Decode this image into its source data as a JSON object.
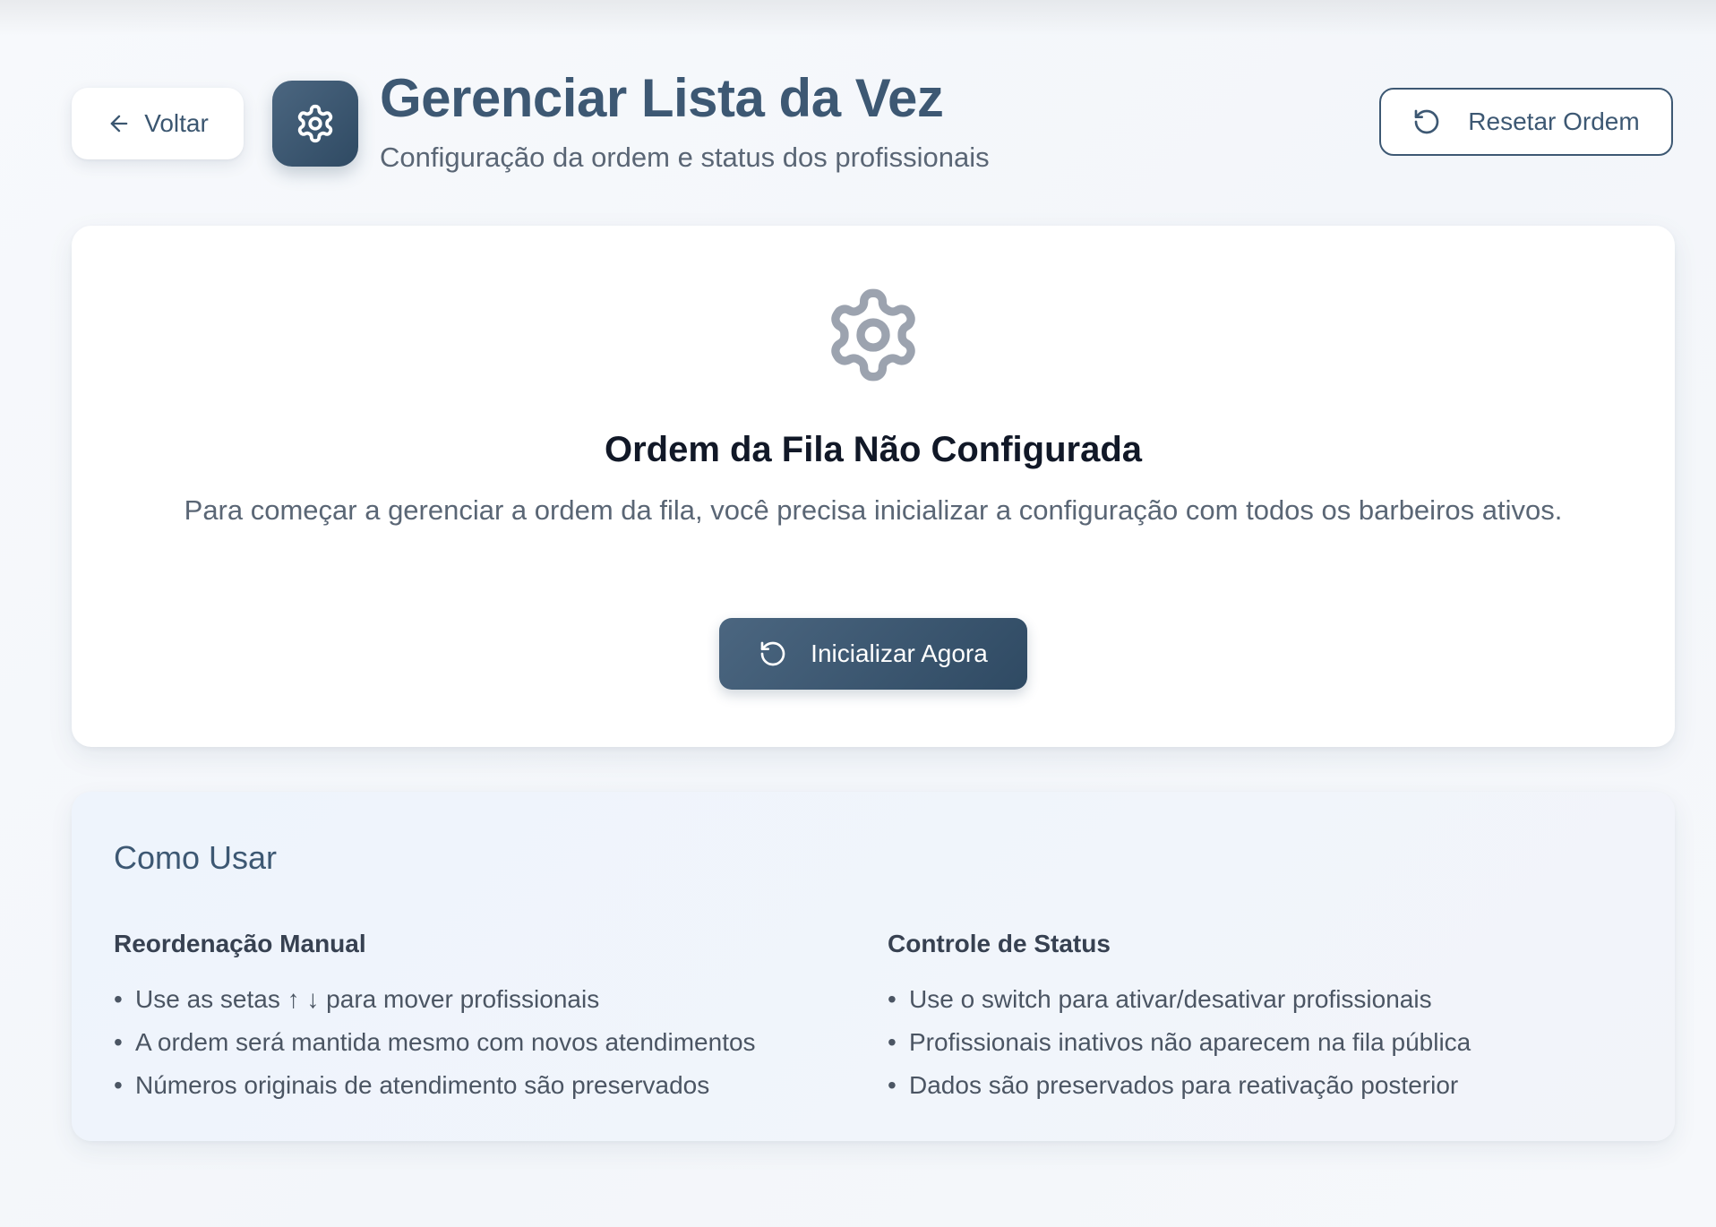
{
  "header": {
    "back_label": "Voltar",
    "title": "Gerenciar Lista da Vez",
    "subtitle": "Configuração da ordem e status dos profissionais",
    "reset_label": "Resetar Ordem"
  },
  "empty_state": {
    "icon": "gear-icon",
    "title": "Ordem da Fila Não Configurada",
    "description": "Para começar a gerenciar a ordem da fila, você precisa inicializar a configuração com todos os barbeiros ativos.",
    "action_label": "Inicializar Agora"
  },
  "help": {
    "title": "Como Usar",
    "sections": [
      {
        "heading": "Reordenação Manual",
        "items": [
          "Use as setas ↑ ↓ para mover profissionais",
          "A ordem será mantida mesmo com novos atendimentos",
          "Números originais de atendimento são preservados"
        ]
      },
      {
        "heading": "Controle de Status",
        "items": [
          "Use o switch para ativar/desativar profissionais",
          "Profissionais inativos não aparecem na fila pública",
          "Dados são preservados para reativação posterior"
        ]
      }
    ]
  },
  "colors": {
    "primary": "#3d5873",
    "primary_dark": "#2f4a63",
    "muted_text": "#5a6675",
    "icon_gray": "#9ca3af",
    "help_background": "#eef4fc"
  }
}
